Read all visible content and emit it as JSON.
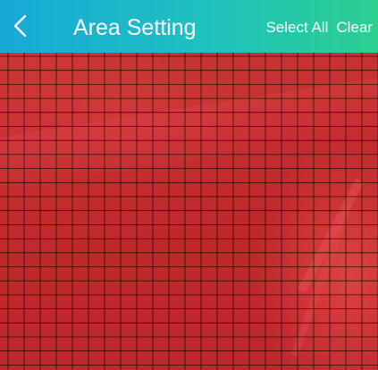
{
  "header": {
    "title": "Area Setting",
    "select_all_label": "Select All",
    "clear_label": "Clear",
    "back_icon": "chevron-left-icon",
    "gradient_start": "#17a9d8",
    "gradient_end": "#2ccf8f"
  },
  "area_grid": {
    "columns": 22,
    "rows": 22,
    "selected": "all",
    "selection_color": "#e42226",
    "line_color": "#000000"
  }
}
